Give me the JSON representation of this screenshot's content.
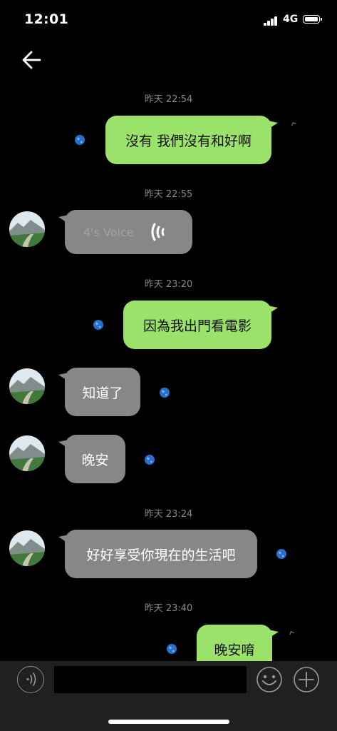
{
  "status_bar": {
    "time": "12:01",
    "network": "4G"
  },
  "messages": [
    {
      "type": "time",
      "text": "昨天 22:54"
    },
    {
      "type": "sent",
      "text": "沒有 我們沒有和好啊"
    },
    {
      "type": "time",
      "text": "昨天 22:55"
    },
    {
      "type": "received_voice",
      "label": "4's Voice"
    },
    {
      "type": "time",
      "text": "昨天 23:20"
    },
    {
      "type": "sent",
      "text": "因為我出門看電影"
    },
    {
      "type": "received",
      "text": "知道了"
    },
    {
      "type": "received",
      "text": "晚安"
    },
    {
      "type": "time",
      "text": "昨天 23:24"
    },
    {
      "type": "received",
      "text": "好好享受你現在的生活吧"
    },
    {
      "type": "time",
      "text": "昨天 23:40"
    },
    {
      "type": "sent",
      "text": "晚安唷"
    }
  ],
  "colors": {
    "sent_bubble": "#9be26a",
    "received_bubble": "#878787",
    "background": "#000000"
  },
  "input": {
    "value": "",
    "placeholder": ""
  },
  "icons": {
    "back": "back-arrow-icon",
    "voice": "voice-input-icon",
    "emoji": "emoji-icon",
    "plus": "plus-icon",
    "globe": "globe-icon"
  }
}
